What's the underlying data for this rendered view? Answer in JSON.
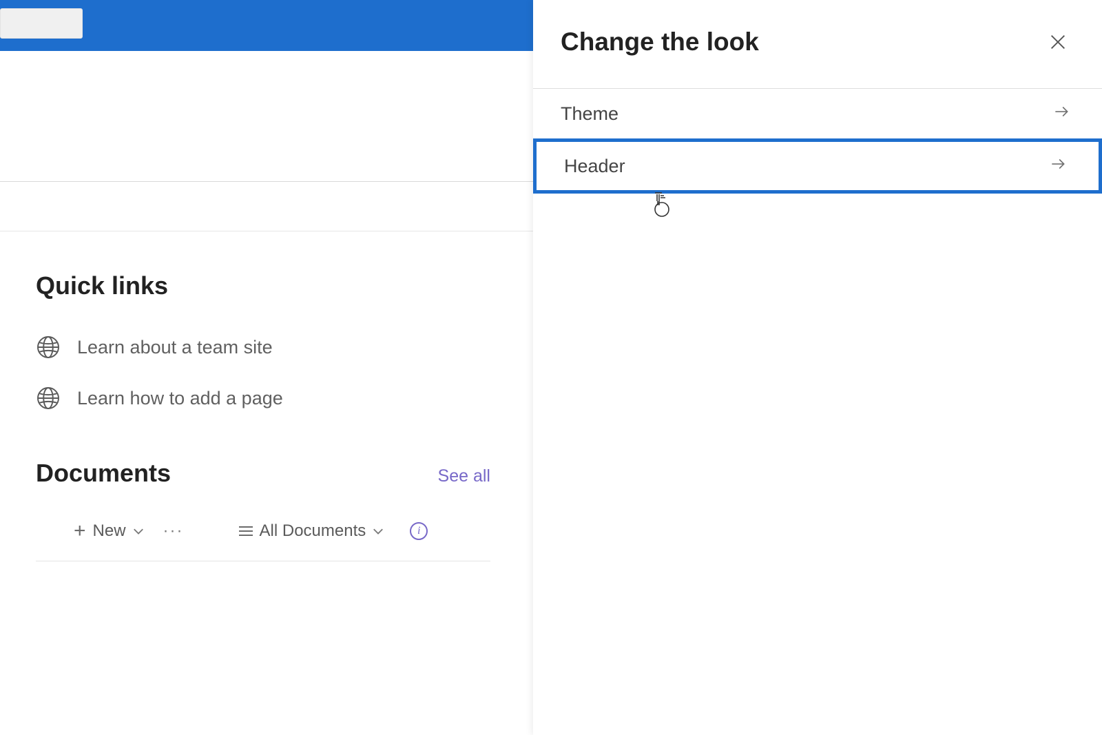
{
  "topBar": {},
  "quickLinks": {
    "heading": "Quick links",
    "items": [
      {
        "label": "Learn about a team site"
      },
      {
        "label": "Learn how to add a page"
      }
    ]
  },
  "documents": {
    "heading": "Documents",
    "seeAll": "See all",
    "newLabel": "New",
    "viewLabel": "All Documents"
  },
  "panel": {
    "title": "Change the look",
    "options": [
      {
        "label": "Theme"
      },
      {
        "label": "Header"
      }
    ]
  }
}
